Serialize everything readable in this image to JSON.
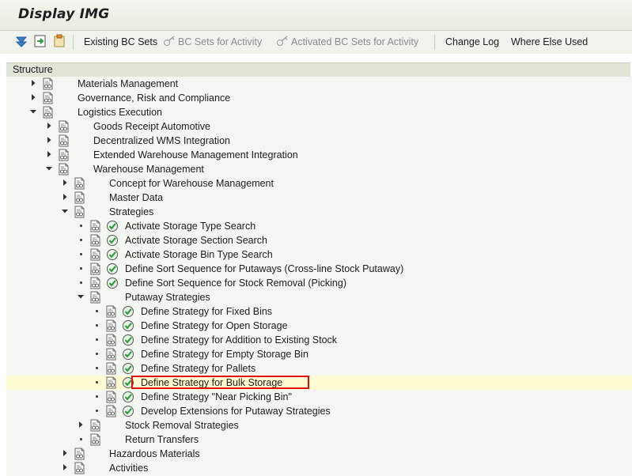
{
  "window": {
    "title": "Display IMG"
  },
  "toolbar": {
    "buttons": [
      {
        "label": "Existing BC Sets",
        "enabled": true
      },
      {
        "label": "BC Sets for Activity",
        "enabled": false
      },
      {
        "label": "Activated BC Sets for Activity",
        "enabled": false
      },
      {
        "label": "Change Log",
        "enabled": true
      },
      {
        "label": "Where Else Used",
        "enabled": true
      }
    ],
    "icons": [
      "find-icon",
      "find-next-icon",
      "clipboard-icon"
    ]
  },
  "structure": {
    "header": "Structure",
    "rows": [
      {
        "label": "Materials Management",
        "expander": "collapsed",
        "activity": false
      },
      {
        "label": "Governance, Risk and Compliance",
        "expander": "collapsed",
        "activity": false
      },
      {
        "label": "Logistics Execution",
        "expander": "expanded",
        "activity": false
      },
      {
        "label": "Goods Receipt Automotive",
        "expander": "collapsed",
        "activity": false
      },
      {
        "label": "Decentralized WMS Integration",
        "expander": "collapsed",
        "activity": false
      },
      {
        "label": "Extended Warehouse Management Integration",
        "expander": "collapsed",
        "activity": false
      },
      {
        "label": "Warehouse Management",
        "expander": "expanded",
        "activity": false
      },
      {
        "label": "Concept for Warehouse Management",
        "expander": "collapsed",
        "activity": false
      },
      {
        "label": "Master Data",
        "expander": "collapsed",
        "activity": false
      },
      {
        "label": "Strategies",
        "expander": "expanded",
        "activity": false
      },
      {
        "label": "Activate Storage Type Search",
        "expander": "leaf",
        "activity": true
      },
      {
        "label": "Activate Storage Section Search",
        "expander": "leaf",
        "activity": true
      },
      {
        "label": "Activate Storage Bin Type Search",
        "expander": "leaf",
        "activity": true
      },
      {
        "label": "Define Sort Sequence for Putaways (Cross-line Stock Putaway)",
        "expander": "leaf",
        "activity": true
      },
      {
        "label": "Define Sort Sequence for Stock Removal (Picking)",
        "expander": "leaf",
        "activity": true
      },
      {
        "label": "Putaway Strategies",
        "expander": "expanded",
        "activity": false
      },
      {
        "label": "Define Strategy for Fixed Bins",
        "expander": "leaf",
        "activity": true
      },
      {
        "label": "Define Strategy for Open Storage",
        "expander": "leaf",
        "activity": true
      },
      {
        "label": "Define Strategy for Addition to Existing Stock",
        "expander": "leaf",
        "activity": true
      },
      {
        "label": "Define Strategy for Empty Storage Bin",
        "expander": "leaf",
        "activity": true
      },
      {
        "label": "Define Strategy for Pallets",
        "expander": "leaf",
        "activity": true
      },
      {
        "label": "Define Strategy for Bulk Storage",
        "expander": "leaf",
        "activity": true,
        "selected": true
      },
      {
        "label": "Define Strategy \"Near Picking Bin\"",
        "expander": "leaf",
        "activity": true
      },
      {
        "label": "Develop Extensions for Putaway Strategies",
        "expander": "leaf",
        "activity": true
      },
      {
        "label": "Stock Removal Strategies",
        "expander": "collapsed",
        "activity": false
      },
      {
        "label": "Return Transfers",
        "expander": "leaf",
        "activity": false
      },
      {
        "label": "Hazardous Materials",
        "expander": "collapsed",
        "activity": false
      },
      {
        "label": "Activities",
        "expander": "collapsed",
        "activity": false
      }
    ]
  },
  "colors": {
    "selection_outline": "#e01010",
    "selected_row": "#fefcd0",
    "activity_icon": "#2e9e3a"
  }
}
